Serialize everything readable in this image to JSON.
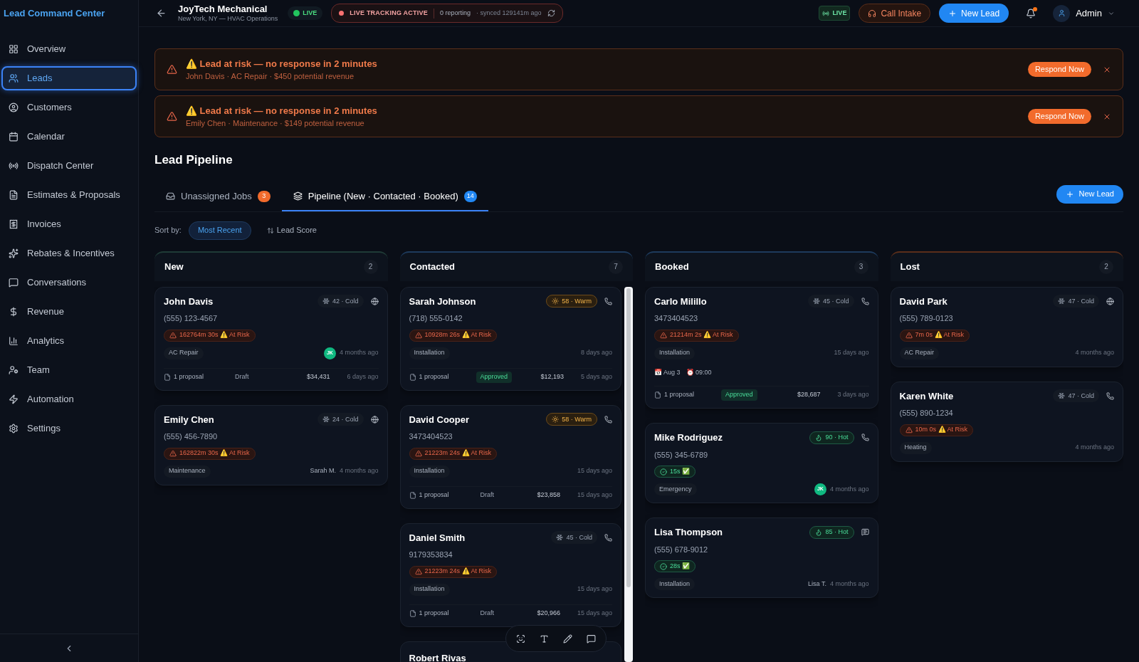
{
  "sidebar": {
    "title": "Lead Command Center",
    "items": [
      {
        "label": "Overview",
        "selected": false
      },
      {
        "label": "Leads",
        "selected": true
      },
      {
        "label": "Customers",
        "selected": false
      },
      {
        "label": "Calendar",
        "selected": false
      },
      {
        "label": "Dispatch Center",
        "selected": false
      },
      {
        "label": "Estimates & Proposals",
        "selected": false
      },
      {
        "label": "Invoices",
        "selected": false
      },
      {
        "label": "Rebates & Incentives",
        "selected": false
      },
      {
        "label": "Conversations",
        "selected": false
      },
      {
        "label": "Revenue",
        "selected": false
      },
      {
        "label": "Analytics",
        "selected": false
      },
      {
        "label": "Team",
        "selected": false
      },
      {
        "label": "Automation",
        "selected": false
      },
      {
        "label": "Settings",
        "selected": false
      }
    ]
  },
  "header": {
    "company": "JoyTech Mechanical",
    "location": "New York, NY — HVAC Operations",
    "live_badge": "LIVE",
    "tracking": {
      "label": "LIVE TRACKING ACTIVE",
      "reporting": "0 reporting",
      "synced": "· synced 129141m ago"
    },
    "live_chip": "LIVE",
    "call_intake": "Call Intake",
    "new_lead": "New Lead",
    "notifications_unread": true,
    "user": "Admin"
  },
  "alerts": [
    {
      "title": "⚠️ Lead at risk — no response in 2 minutes",
      "detail": "John Davis · AC Repair · $450 potential revenue",
      "action": "Respond Now"
    },
    {
      "title": "⚠️ Lead at risk — no response in 2 minutes",
      "detail": "Emily Chen · Maintenance · $149 potential revenue",
      "action": "Respond Now"
    }
  ],
  "pipeline": {
    "title": "Lead Pipeline",
    "tabs": [
      {
        "label": "Unassigned Jobs",
        "count": "3",
        "selected": false
      },
      {
        "label": "Pipeline (New · Contacted · Booked)",
        "count": "14",
        "selected": true
      }
    ],
    "new_lead": "New Lead",
    "sort_label": "Sort by:",
    "sort_options": [
      {
        "label": "Most Recent",
        "selected": true
      },
      {
        "label": "Lead Score",
        "selected": false
      }
    ],
    "columns": [
      {
        "title": "New",
        "count": "2",
        "color": "#1f3b36",
        "cards": [
          {
            "name": "John Davis",
            "phone": "(555) 123-4567",
            "score": {
              "text": "42 · Cold",
              "kind": "cold"
            },
            "contact": {
              "kind": "web"
            },
            "timer": {
              "text": "162764m 30s ⚠️ At Risk",
              "at_risk": true
            },
            "tag": "AC Repair",
            "assignee": {
              "kind": "avatar",
              "text": "JK"
            },
            "age": "4 months ago",
            "proposal": {
              "count": "1 proposal",
              "status": "Draft",
              "approved": false,
              "amount": "$34,431",
              "age": "6 days ago"
            }
          },
          {
            "name": "Emily Chen",
            "phone": "(555) 456-7890",
            "score": {
              "text": "24 · Cold",
              "kind": "cold"
            },
            "contact": {
              "kind": "web"
            },
            "timer": {
              "text": "162822m 30s ⚠️ At Risk",
              "at_risk": true
            },
            "tag": "Maintenance",
            "assignee": {
              "kind": "name",
              "text": "Sarah M."
            },
            "age": "4 months ago"
          }
        ]
      },
      {
        "title": "Contacted",
        "count": "7",
        "color": "#1d3a5c",
        "cards": [
          {
            "name": "Sarah Johnson",
            "phone": "(718) 555-0142",
            "score": {
              "text": "58 · Warm",
              "kind": "warm"
            },
            "contact": {
              "kind": "phone"
            },
            "timer": {
              "text": "10928m 26s ⚠️ At Risk",
              "at_risk": true
            },
            "tag": "Installation",
            "age": "8 days ago",
            "proposal": {
              "count": "1 proposal",
              "status": "Approved",
              "approved": true,
              "amount": "$12,193",
              "age": "5 days ago"
            }
          },
          {
            "name": "David Cooper",
            "phone": "3473404523",
            "score": {
              "text": "58 · Warm",
              "kind": "warm"
            },
            "contact": {
              "kind": "phone"
            },
            "timer": {
              "text": "21223m 24s ⚠️ At Risk",
              "at_risk": true
            },
            "tag": "Installation",
            "age": "15 days ago",
            "proposal": {
              "count": "1 proposal",
              "status": "Draft",
              "approved": false,
              "amount": "$23,858",
              "age": "15 days ago"
            }
          },
          {
            "name": "Daniel Smith",
            "phone": "9179353834",
            "score": {
              "text": "45 · Cold",
              "kind": "cold"
            },
            "contact": {
              "kind": "phone"
            },
            "timer": {
              "text": "21223m 24s ⚠️ At Risk",
              "at_risk": true
            },
            "tag": "Installation",
            "age": "15 days ago",
            "proposal": {
              "count": "1 proposal",
              "status": "Draft",
              "approved": false,
              "amount": "$20,966",
              "age": "15 days ago"
            }
          },
          {
            "name": "Robert Rivas"
          }
        ]
      },
      {
        "title": "Booked",
        "count": "3",
        "color": "#1d3a5c",
        "cards": [
          {
            "name": "Carlo Milillo",
            "phone": "3473404523",
            "score": {
              "text": "45 · Cold",
              "kind": "cold"
            },
            "contact": {
              "kind": "phone"
            },
            "timer": {
              "text": "21214m 2s ⚠️ At Risk",
              "at_risk": true
            },
            "tag": "Installation",
            "age": "15 days ago",
            "schedule": {
              "date": "📅 Aug 3",
              "time": "⏰ 09:00"
            },
            "proposal": {
              "count": "1 proposal",
              "status": "Approved",
              "approved": true,
              "amount": "$28,687",
              "age": "3 days ago"
            }
          },
          {
            "name": "Mike Rodriguez",
            "phone": "(555) 345-6789",
            "score": {
              "text": "90 · Hot",
              "kind": "hot"
            },
            "contact": {
              "kind": "phone"
            },
            "timer": {
              "text": "15s ✅",
              "at_risk": false
            },
            "tag": "Emergency",
            "assignee": {
              "kind": "avatar",
              "text": "JK"
            },
            "age": "4 months ago"
          },
          {
            "name": "Lisa Thompson",
            "phone": "(555) 678-9012",
            "score": {
              "text": "85 · Hot",
              "kind": "hot"
            },
            "contact": {
              "kind": "chat"
            },
            "timer": {
              "text": "28s ✅",
              "at_risk": false
            },
            "tag": "Installation",
            "assignee": {
              "kind": "name",
              "text": "Lisa T."
            },
            "age": "4 months ago"
          }
        ]
      },
      {
        "title": "Lost",
        "count": "2",
        "color": "#5a2e1a",
        "cards": [
          {
            "name": "David Park",
            "phone": "(555) 789-0123",
            "score": {
              "text": "47 · Cold",
              "kind": "cold"
            },
            "contact": {
              "kind": "web"
            },
            "timer": {
              "text": "7m 0s ⚠️ At Risk",
              "at_risk": true
            },
            "tag": "AC Repair",
            "age": "4 months ago"
          },
          {
            "name": "Karen White",
            "phone": "(555) 890-1234",
            "score": {
              "text": "47 · Cold",
              "kind": "cold"
            },
            "contact": {
              "kind": "phone"
            },
            "timer": {
              "text": "10m 0s ⚠️ At Risk",
              "at_risk": true
            },
            "tag": "Heating",
            "age": "4 months ago"
          }
        ]
      }
    ]
  }
}
